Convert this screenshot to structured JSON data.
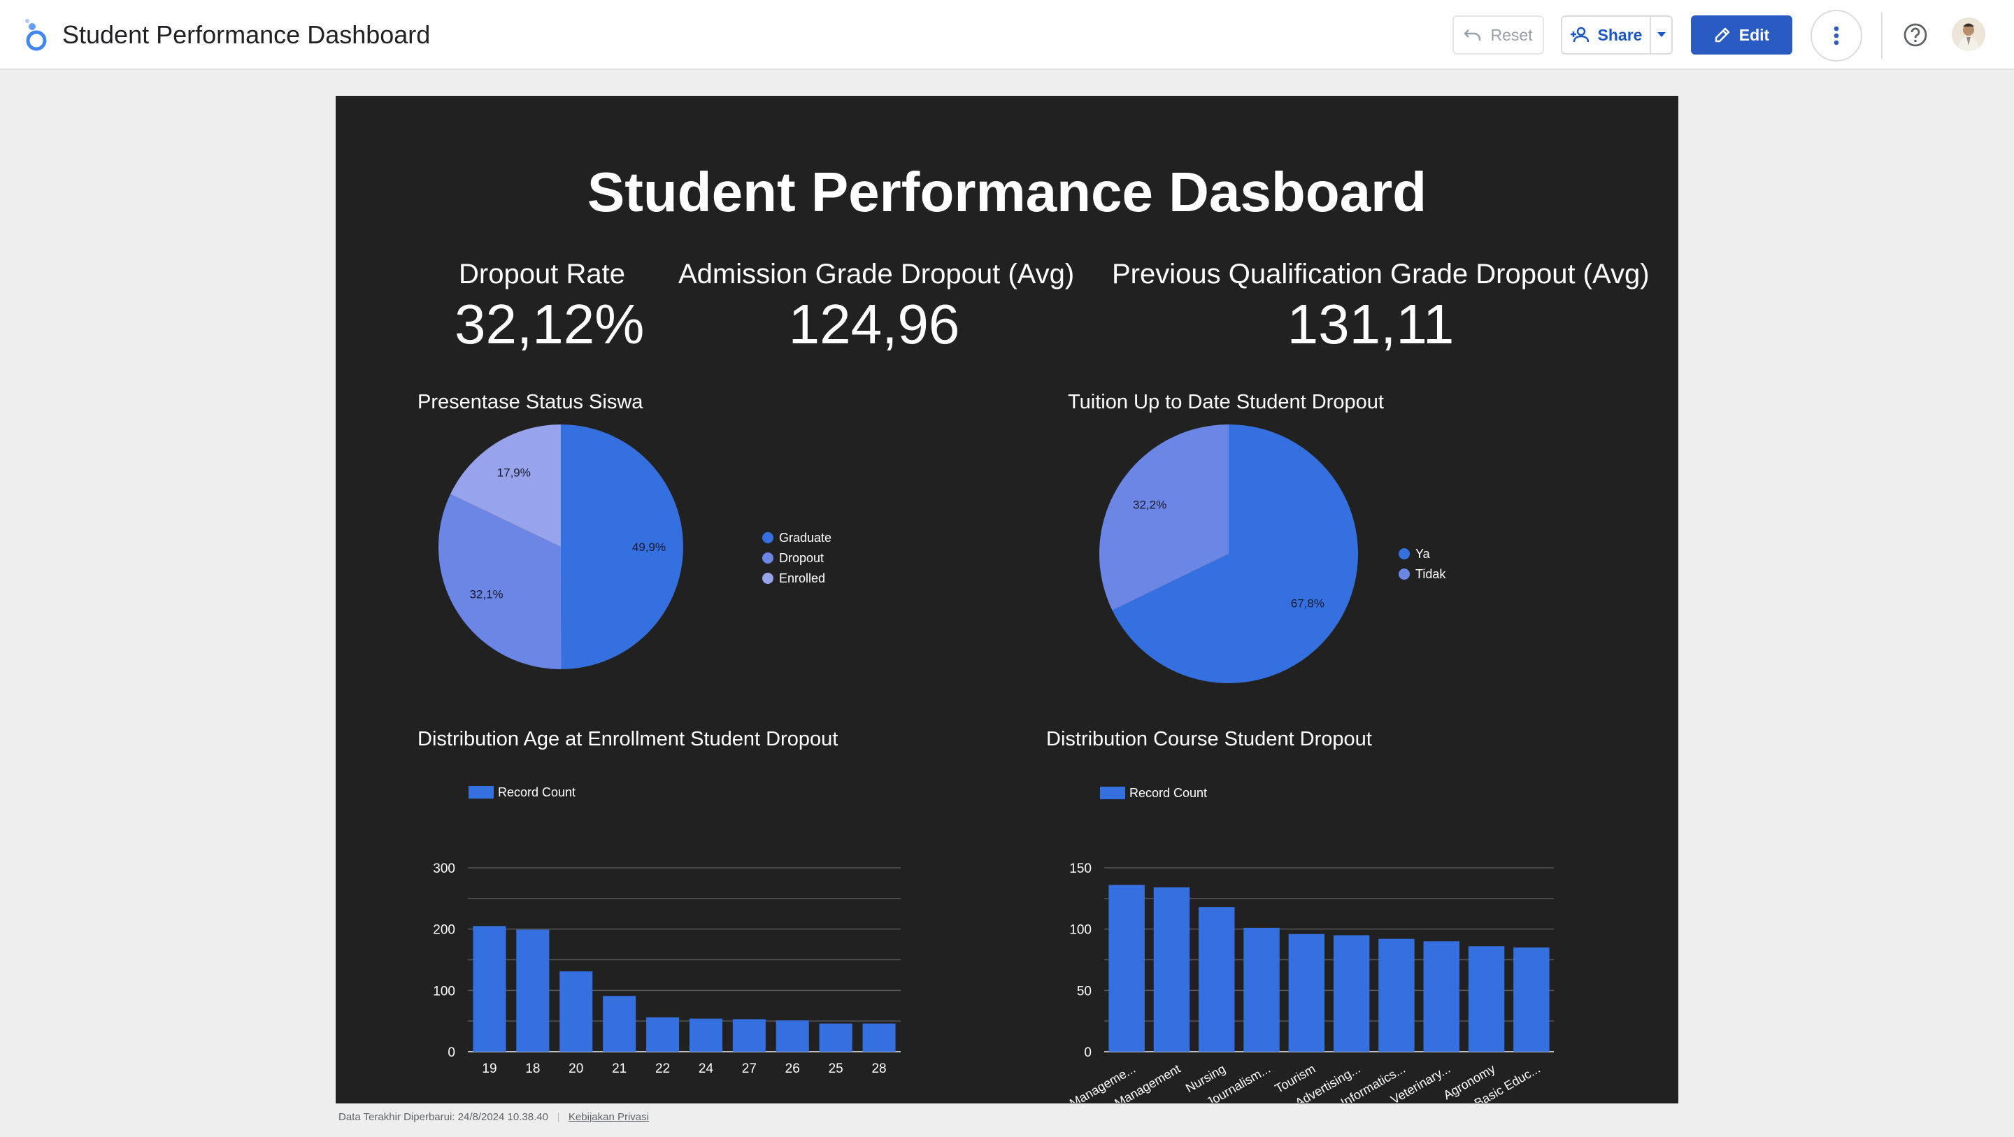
{
  "header": {
    "title": "Student Performance Dashboard",
    "reset_label": "Reset",
    "share_label": "Share",
    "edit_label": "Edit"
  },
  "colors": {
    "canvas_bg": "#212121",
    "series_primary": "#3570e0",
    "series_secondary": "#6c86e5",
    "series_tertiary": "#97a3ea",
    "edit_button": "#2a5bc2"
  },
  "report": {
    "title": "Student Performance Dasboard",
    "kpis": [
      {
        "label": "Dropout Rate",
        "value": "32,12%"
      },
      {
        "label": "Admission Grade Dropout (Avg)",
        "value": "124,96"
      },
      {
        "label": "Previous Qualification Grade Dropout (Avg)",
        "value": "131,11"
      }
    ]
  },
  "chart_data": [
    {
      "type": "pie",
      "title": "Presentase Status Siswa",
      "labels": [
        "Graduate",
        "Dropout",
        "Enrolled"
      ],
      "values": [
        49.9,
        32.1,
        17.9
      ],
      "value_labels": [
        "49,9%",
        "32,1%",
        "17,9%"
      ],
      "colors": [
        "#3570e0",
        "#6c86e5",
        "#97a3ea"
      ],
      "legend": "right"
    },
    {
      "type": "pie",
      "title": "Tuition Up to Date Student Dropout",
      "labels": [
        "Ya",
        "Tidak"
      ],
      "values": [
        67.8,
        32.2
      ],
      "value_labels": [
        "67,8%",
        "32,2%"
      ],
      "colors": [
        "#3570e0",
        "#6c86e5"
      ],
      "legend": "right"
    },
    {
      "type": "bar",
      "title": "Distribution Age at Enrollment Student Dropout",
      "categories": [
        "19",
        "18",
        "20",
        "21",
        "22",
        "24",
        "27",
        "26",
        "25",
        "28"
      ],
      "series": [
        {
          "name": "Record Count",
          "values": [
            205,
            199,
            131,
            91,
            56,
            54,
            53,
            51,
            46,
            46
          ]
        }
      ],
      "ylim": [
        0,
        300
      ],
      "yticks": [
        "0",
        "100",
        "200",
        "300"
      ],
      "grid": true,
      "legend": "top-left"
    },
    {
      "type": "bar",
      "title": "Distribution Course Student Dropout",
      "categories": [
        "Manageme...",
        "Management",
        "Nursing",
        "Journalism...",
        "Tourism",
        "Advertising...",
        "Informatics...",
        "Veterinary...",
        "Agronomy",
        "Basic Educ..."
      ],
      "series": [
        {
          "name": "Record Count",
          "values": [
            136,
            134,
            118,
            101,
            96,
            95,
            92,
            90,
            86,
            85
          ]
        }
      ],
      "ylim": [
        0,
        150
      ],
      "yticks": [
        "0",
        "50",
        "100",
        "150"
      ],
      "grid": true,
      "legend": "top-left"
    }
  ],
  "footer": {
    "last_updated": "Data Terakhir Diperbarui: 24/8/2024 10.38.40",
    "privacy_link": "Kebijakan Privasi"
  }
}
